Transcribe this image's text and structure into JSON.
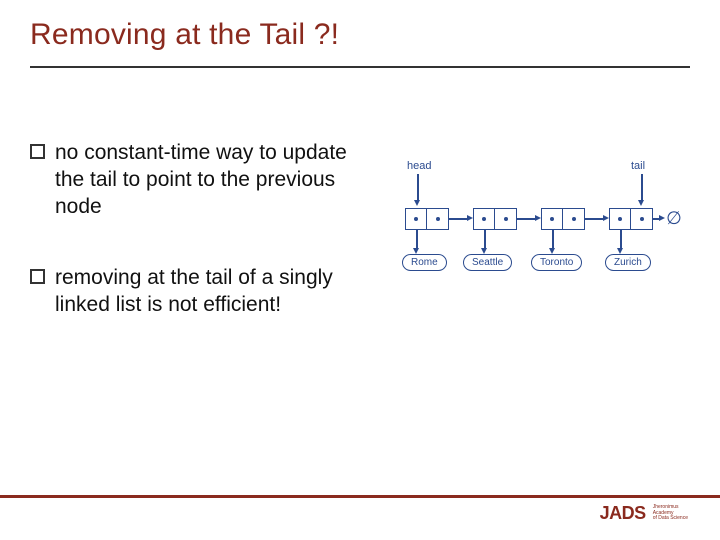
{
  "title": "Removing at the Tail ?!",
  "bullets": [
    "no constant-time way to update the tail to point to the previous node",
    "removing at the tail of a singly linked list is not efficient!"
  ],
  "diagram": {
    "head_label": "head",
    "tail_label": "tail",
    "null_symbol": "∅",
    "cities": [
      "Rome",
      "Seattle",
      "Toronto",
      "Zurich"
    ]
  },
  "logo": {
    "text": "JADS",
    "sub1": "Jheronimus",
    "sub2": "Academy",
    "sub3": "of Data Science"
  }
}
